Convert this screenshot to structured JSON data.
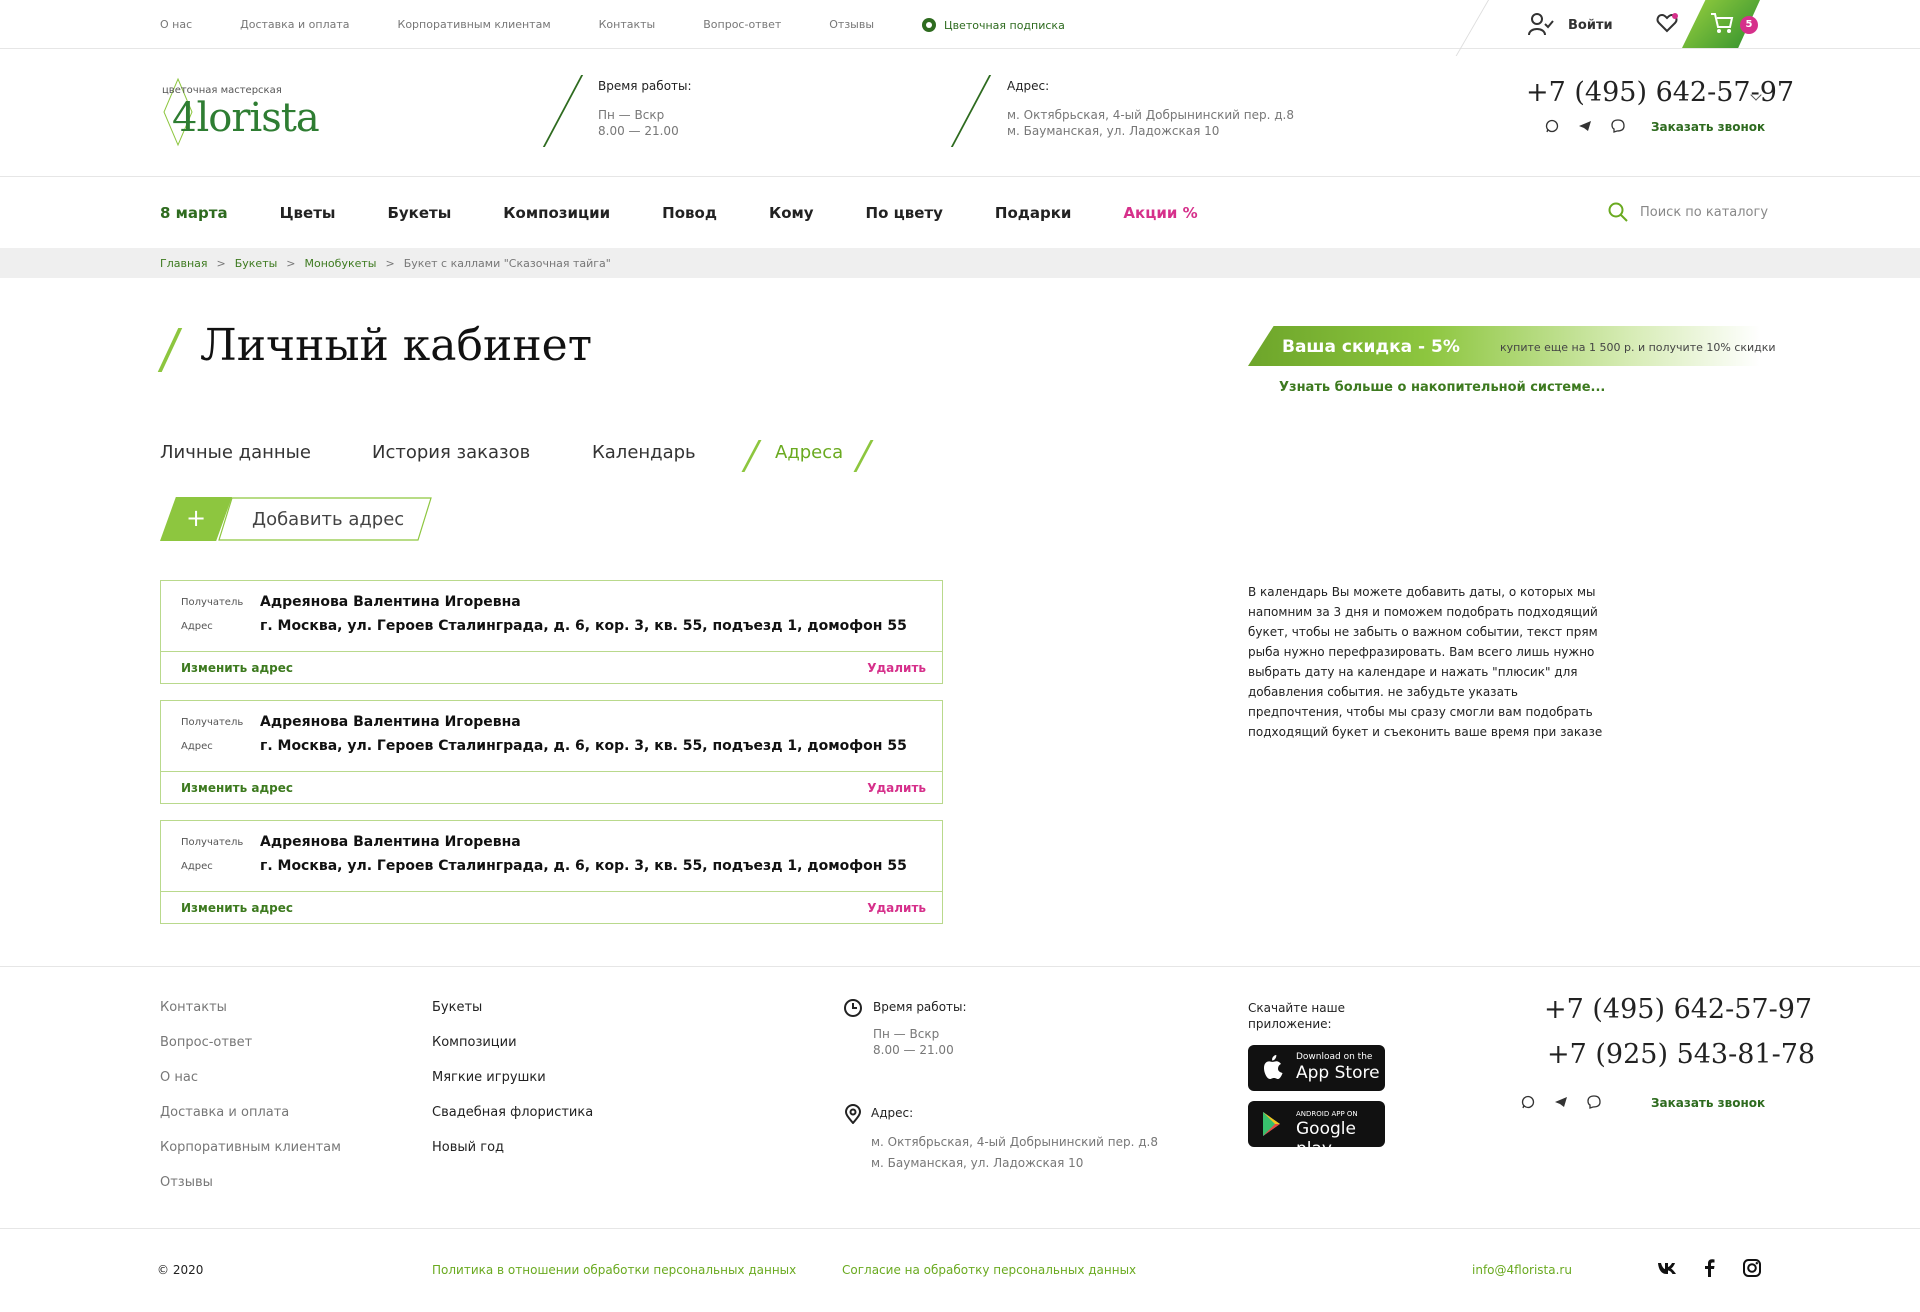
{
  "topnav": {
    "items": [
      "О нас",
      "Доставка и оплата",
      "Корпоративным клиентам",
      "Контакты",
      "Вопрос-ответ",
      "Отзывы"
    ],
    "subscription": "Цветочная подписка",
    "login": "Войти",
    "cart_count": "5"
  },
  "header": {
    "logo_sub": "цветочная мастерская",
    "logo_main": "4lorista",
    "hours_label": "Время работы:",
    "hours_days": "Пн — Вскр",
    "hours_time": "8.00 — 21.00",
    "address_label": "Адрес:",
    "address_1": "м. Октябрьская, 4-ый Добрынинский пер. д.8",
    "address_2": "м. Бауманская, ул. Ладожская 10",
    "phone": "+7 (495) 642-57-97",
    "callback": "Заказать звонок"
  },
  "mainnav": {
    "items": [
      "8 марта",
      "Цветы",
      "Букеты",
      "Композиции",
      "Повод",
      "Кому",
      "По цвету",
      "Подарки",
      "Акции %"
    ],
    "search_placeholder": "Поиск по каталогу"
  },
  "breadcrumb": [
    "Главная",
    "Букеты",
    "Монобукеты",
    "Букет с каллами \"Сказочная тайга\""
  ],
  "page": {
    "title": "Личный кабинет",
    "discount_title": "Ваша скидка - 5%",
    "discount_note": "купите еще на 1 500 р. и получите 10% скидки",
    "discount_link": "Узнать больше о накопительной системе...",
    "tabs": [
      "Личные данные",
      "История заказов",
      "Календарь",
      "Адреса"
    ],
    "active_tab": "Адреса",
    "add_plus": "+",
    "add_label": "Добавить адрес"
  },
  "addresses": [
    {
      "recipient_label": "Получатель",
      "recipient": "Адреянова Валентина Игоревна",
      "address_label": "Адрес",
      "address": "г. Москва, ул. Героев Сталинграда, д. 6, кор. 3, кв. 55, подъезд 1, домофон 55",
      "edit": "Изменить адрес",
      "delete": "Удалить"
    },
    {
      "recipient_label": "Получатель",
      "recipient": "Адреянова Валентина Игоревна",
      "address_label": "Адрес",
      "address": "г. Москва, ул. Героев Сталинграда, д. 6, кор. 3, кв. 55, подъезд 1, домофон 55",
      "edit": "Изменить адрес",
      "delete": "Удалить"
    },
    {
      "recipient_label": "Получатель",
      "recipient": "Адреянова Валентина Игоревна",
      "address_label": "Адрес",
      "address": "г. Москва, ул. Героев Сталинграда, д. 6, кор. 3, кв. 55, подъезд 1, домофон 55",
      "edit": "Изменить адрес",
      "delete": "Удалить"
    }
  ],
  "info_text": "В календарь Вы можете добавить даты, о которых мы напомним за 3 дня и поможем подобрать подходящий букет, чтобы не забыть о важном событии, текст прям рыба нужно перефразировать. Вам всего лишь нужно выбрать дату на календаре и нажать \"плюсик\" для добавления события. не забудьте указать предпочтения, чтобы мы сразу смогли вам подобрать подходящий букет и съеконить ваше время при заказе",
  "footer": {
    "col1": [
      "Контакты",
      "Вопрос-ответ",
      "О нас",
      "Доставка и оплата",
      "Корпоративным клиентам",
      "Отзывы"
    ],
    "col2": [
      "Букеты",
      "Композиции",
      "Мягкие игрушки",
      "Свадебная флористика",
      "Новый год"
    ],
    "hours_label": "Время работы:",
    "hours_days": "Пн — Вскр",
    "hours_time": "8.00 — 21.00",
    "address_label": "Адрес:",
    "address_1": "м. Октябрьская, 4-ый Добрынинский пер. д.8",
    "address_2": "м. Бауманская, ул. Ладожская 10",
    "app_title": "Скачайте наше приложение:",
    "appstore_small": "Download on the",
    "appstore_big": "App Store",
    "gplay_small": "ANDROID APP ON",
    "gplay_big": "Google play",
    "phone_1": "+7 (495) 642-57-97",
    "phone_2": "+7 (925) 543-81-78",
    "callback": "Заказать звонок",
    "copyright": "© 2020",
    "policy": "Политика в отношении обработки персональных данных",
    "consent": "Согласие на обработку персональных данных",
    "email": "info@4florista.ru"
  },
  "colors": {
    "accent_green": "#8dc63f",
    "dark_green": "#2e6b1f",
    "pink": "#d6308b"
  }
}
